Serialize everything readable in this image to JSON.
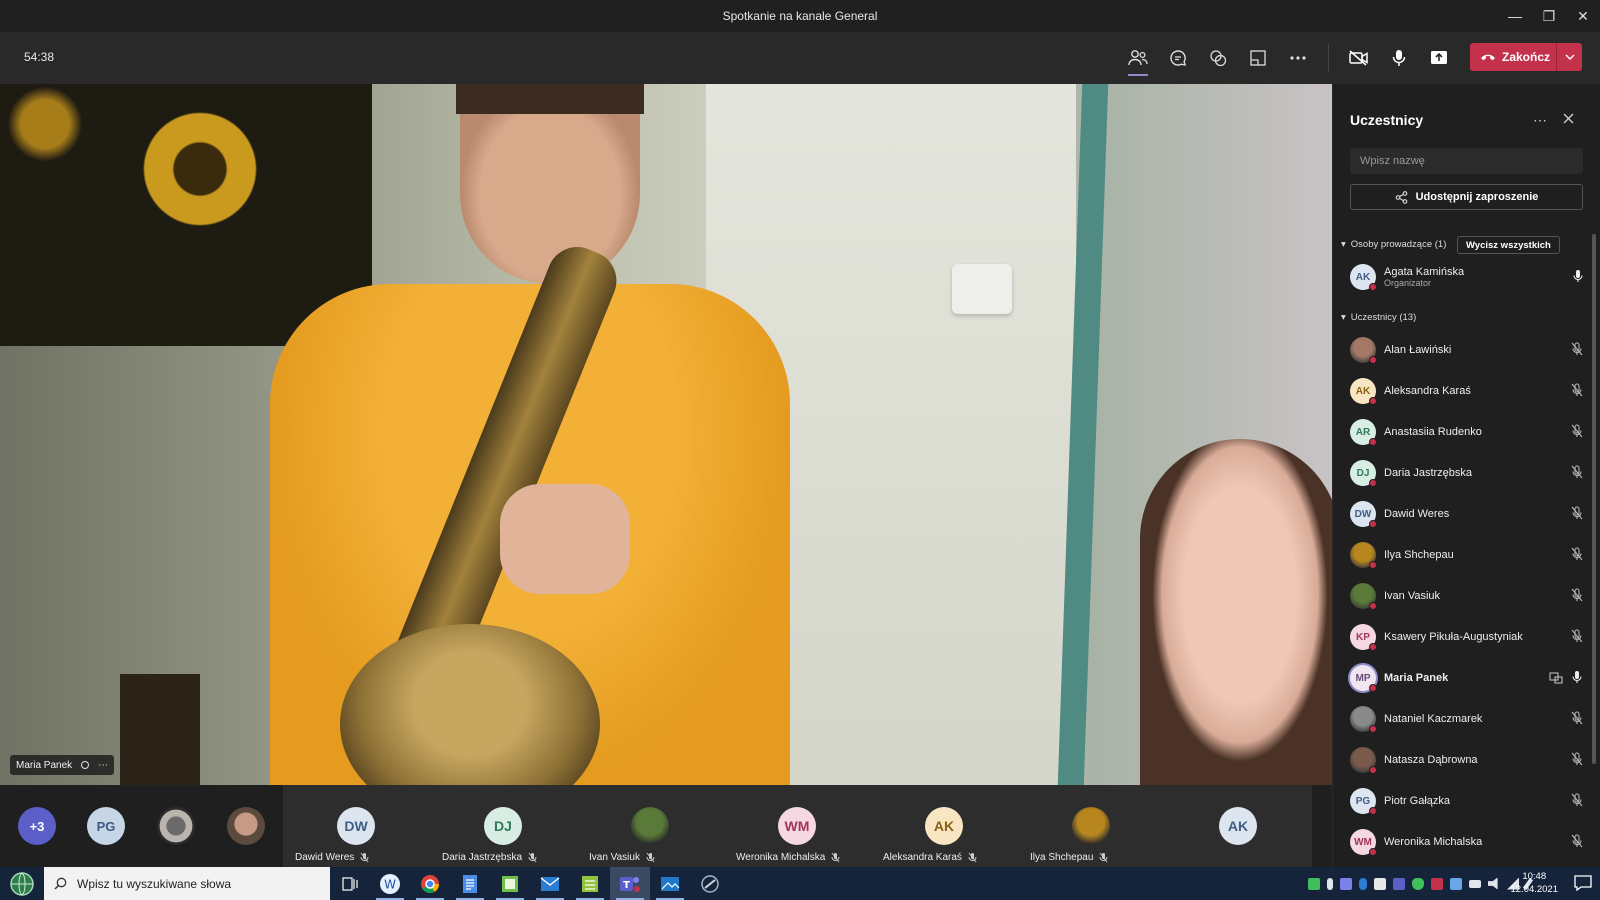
{
  "window": {
    "title": "Spotkanie na kanale General"
  },
  "toolbar": {
    "timer": "54:38",
    "end_label": "Zakończ"
  },
  "video": {
    "speaker_name": "Maria Panek"
  },
  "strip": {
    "overflow_count": "+3",
    "small_avatars": [
      {
        "initials": "PG",
        "color": "#c6d6e6",
        "text": "#3d5a80"
      },
      {
        "initials": "",
        "photo": true
      },
      {
        "initials": "",
        "photo": true
      }
    ],
    "tiles": [
      {
        "initials": "DW",
        "name": "Dawid Weres",
        "bg": "#dde6f0",
        "fg": "#3f5e86"
      },
      {
        "initials": "DJ",
        "name": "Daria Jastrzębska",
        "bg": "#d8eee4",
        "fg": "#2f7a58"
      },
      {
        "initials": "",
        "name": "Ivan Vasiuk",
        "bg": "#5a7a3a",
        "fg": "#fff",
        "photo": true
      },
      {
        "initials": "WM",
        "name": "Weronika Michalska",
        "bg": "#f6d8e3",
        "fg": "#a3345a"
      },
      {
        "initials": "AK",
        "name": "Aleksandra Karaś",
        "bg": "#f8e6c2",
        "fg": "#8a6014"
      },
      {
        "initials": "",
        "name": "Ilya Shchepau",
        "bg": "#b7861f",
        "fg": "#fff",
        "photo": true
      },
      {
        "initials": "AK",
        "name": "",
        "bg": "#dde6f0",
        "fg": "#3f5e86"
      }
    ]
  },
  "panel": {
    "title": "Uczestnicy",
    "search_placeholder": "Wpisz nazwę",
    "share_label": "Udostępnij zaproszenie",
    "presenters_label": "Osoby prowadzące (1)",
    "mute_all_label": "Wycisz wszystkich",
    "presenter": {
      "initials": "AK",
      "name": "Agata Kamińska",
      "role": "Organizator",
      "bg": "#dde6f0",
      "fg": "#3f5e86"
    },
    "attendees_label": "Uczestnicy (13)",
    "attendees": [
      {
        "initials": "",
        "name": "Alan Ławiński",
        "bg": "#a47866",
        "fg": "#fff",
        "photo": true
      },
      {
        "initials": "AK",
        "name": "Aleksandra Karaś",
        "bg": "#f8e6c2",
        "fg": "#8a6014"
      },
      {
        "initials": "AR",
        "name": "Anastasiia Rudenko",
        "bg": "#d8eee4",
        "fg": "#2f7a58"
      },
      {
        "initials": "DJ",
        "name": "Daria Jastrzębska",
        "bg": "#d8eee4",
        "fg": "#2f7a58"
      },
      {
        "initials": "DW",
        "name": "Dawid Weres",
        "bg": "#dde6f0",
        "fg": "#3f5e86"
      },
      {
        "initials": "",
        "name": "Ilya Shchepau",
        "bg": "#b7861f",
        "fg": "#fff",
        "photo": true
      },
      {
        "initials": "",
        "name": "Ivan Vasiuk",
        "bg": "#5a7a3a",
        "fg": "#fff",
        "photo": true
      },
      {
        "initials": "KP",
        "name": "Ksawery Pikuła-Augustyniak",
        "bg": "#f6d8e3",
        "fg": "#a3345a"
      },
      {
        "initials": "MP",
        "name": "Maria Panek",
        "bg": "#efe6f0",
        "fg": "#6b4a7a",
        "speaking": true
      },
      {
        "initials": "",
        "name": "Nataniel Kaczmarek",
        "bg": "#8a8a8a",
        "fg": "#fff",
        "photo": true
      },
      {
        "initials": "",
        "name": "Natasza Dąbrowna",
        "bg": "#7a5a4a",
        "fg": "#fff",
        "photo": true
      },
      {
        "initials": "PG",
        "name": "Piotr Gałązka",
        "bg": "#dde6f0",
        "fg": "#3f5e86"
      },
      {
        "initials": "WM",
        "name": "Weronika Michalska",
        "bg": "#f6d8e3",
        "fg": "#a3345a"
      }
    ]
  },
  "taskbar": {
    "search_placeholder": "Wpisz tu wyszukiwane słowa",
    "time": "10:48",
    "date": "12.04.2021"
  }
}
